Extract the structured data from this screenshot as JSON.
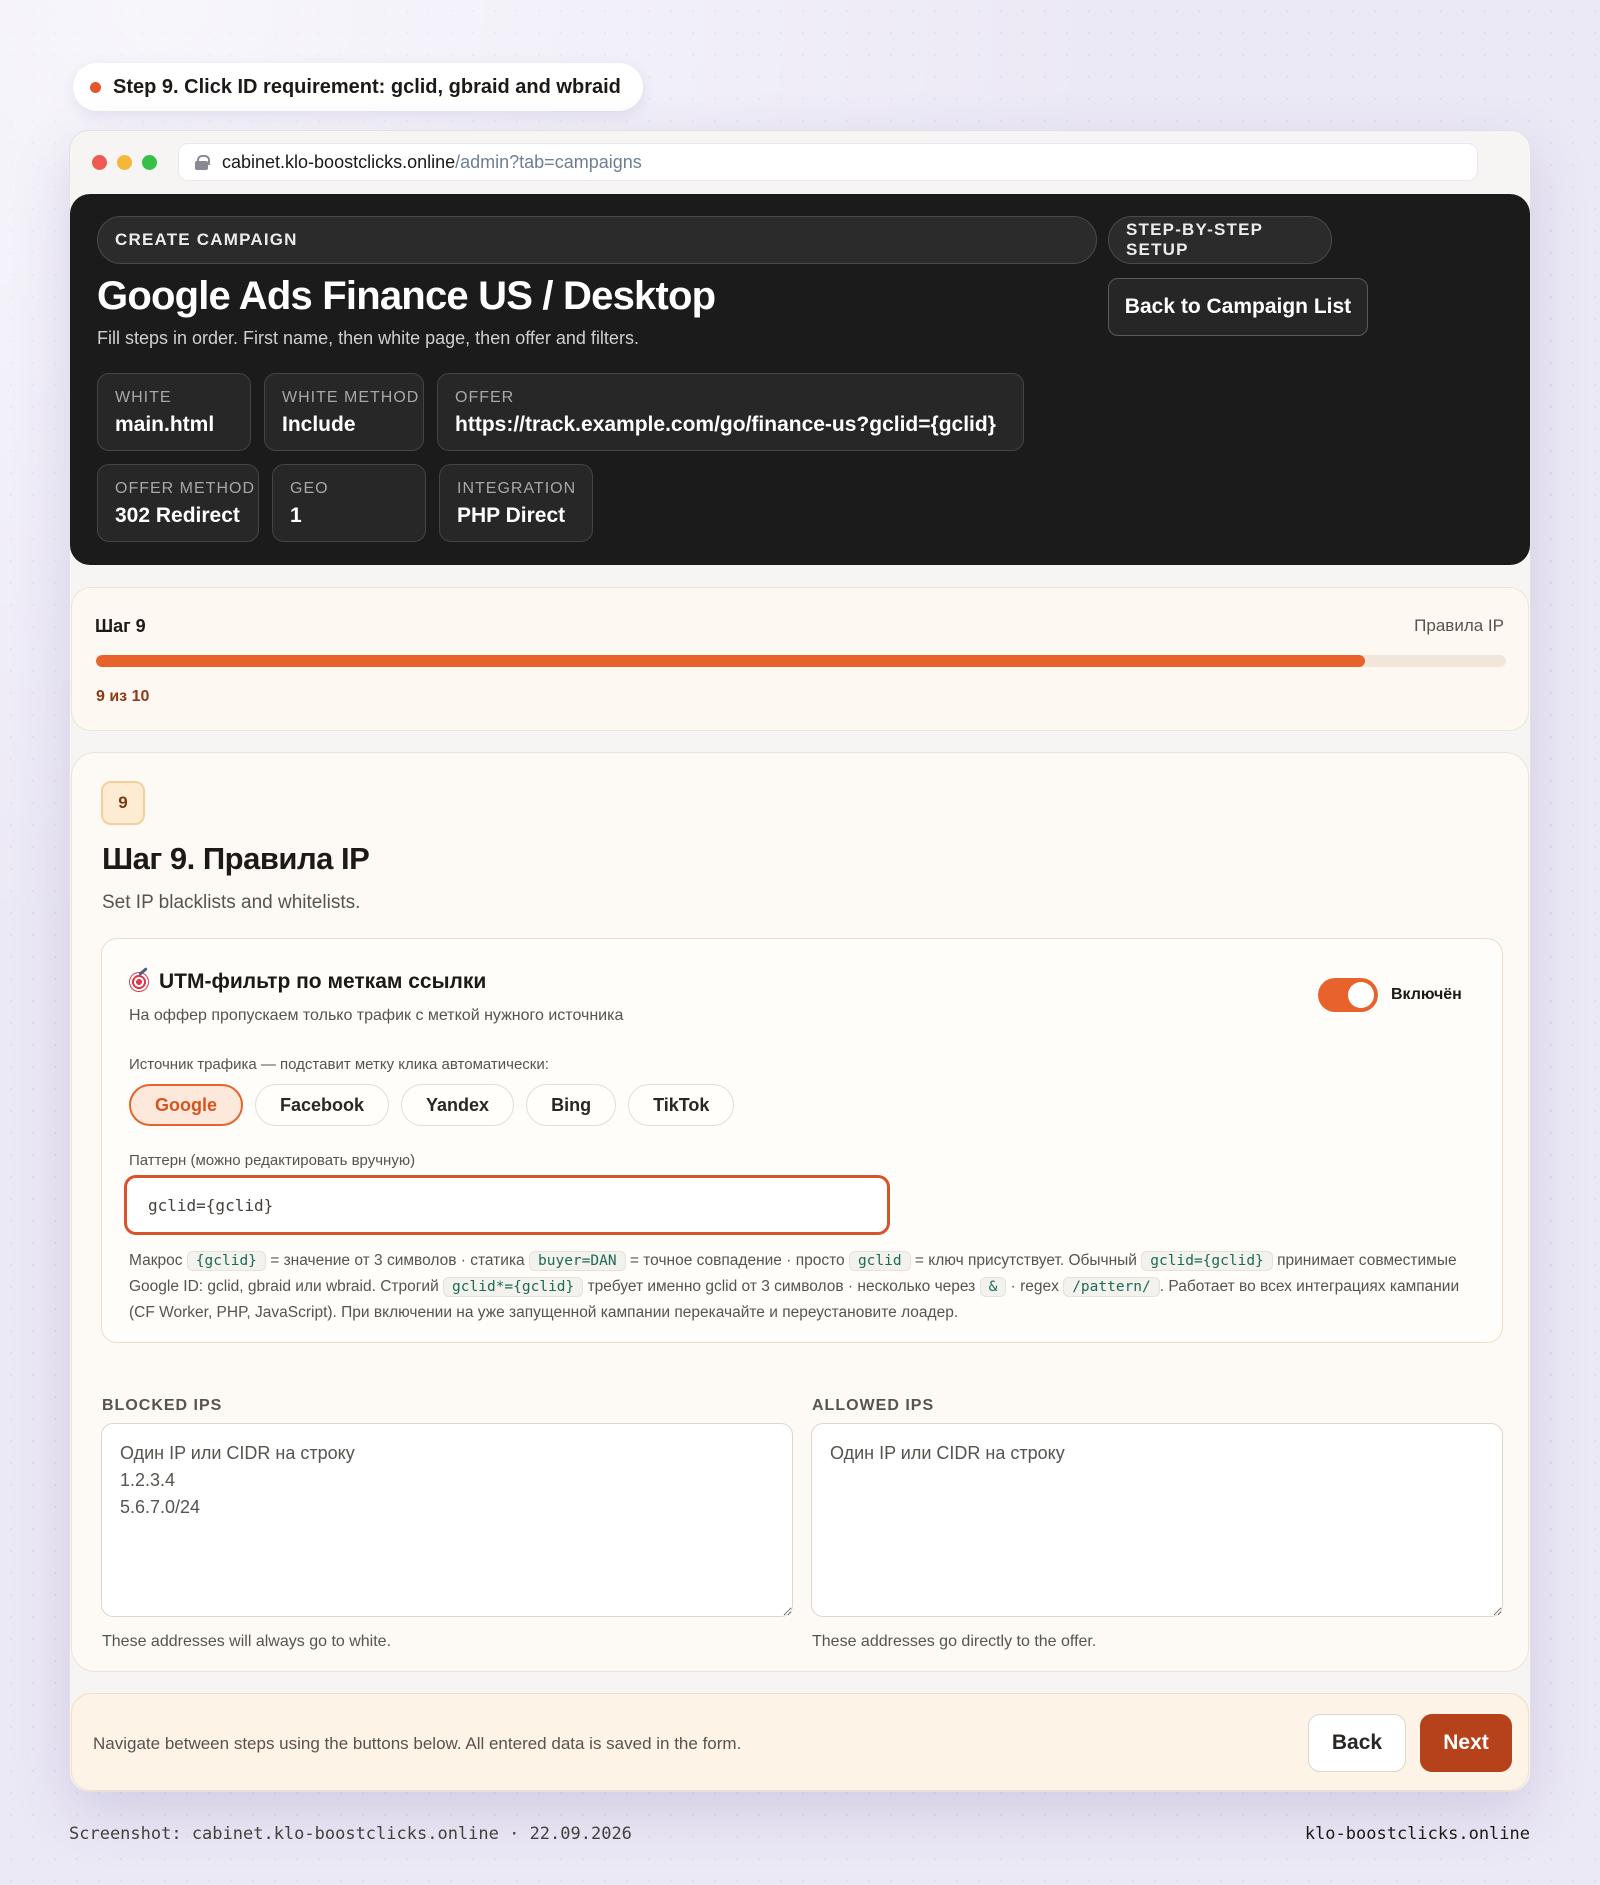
{
  "step_caption": "Step 9. Click ID requirement: gclid, gbraid and wbraid",
  "browser": {
    "url_host": "cabinet.klo-boostclicks.online",
    "url_path": "/admin?tab=campaigns"
  },
  "header": {
    "chip_left": "CREATE CAMPAIGN",
    "chip_right": "STEP-BY-STEP SETUP",
    "title": "Google Ads Finance US / Desktop",
    "subtitle": "Fill steps in order. First name, then white page, then offer and filters.",
    "back_button": "Back to Campaign List",
    "stats": [
      {
        "label": "WHITE",
        "value": "main.html"
      },
      {
        "label": "WHITE METHOD",
        "value": "Include"
      },
      {
        "label": "OFFER",
        "value": "https://track.example.com/go/finance-us?gclid={gclid}"
      },
      {
        "label": "OFFER METHOD",
        "value": "302 Redirect"
      },
      {
        "label": "GEO",
        "value": "1"
      },
      {
        "label": "INTEGRATION",
        "value": "PHP Direct"
      }
    ]
  },
  "progress": {
    "title": "Шаг 9",
    "section": "Правила IP",
    "count_text": "9 из 10",
    "fraction": 0.9,
    "color": "#e8632c"
  },
  "step": {
    "number": "9",
    "heading": "Шаг 9. Правила IP",
    "subtitle": "Set IP blacklists and whitelists."
  },
  "utm": {
    "icon": "target-icon",
    "title": "UTM-фильтр по меткам ссылки",
    "description": "На оффер пропускаем только трафик с меткой нужного источника",
    "toggle_label": "Включён",
    "toggle_on": true,
    "source_label": "Источник трафика — подставит метку клика автоматически:",
    "sources": [
      "Google",
      "Facebook",
      "Yandex",
      "Bing",
      "TikTok"
    ],
    "active_source": "Google",
    "pattern_label": "Паттерн (можно редактировать вручную)",
    "pattern_value": "gclid={gclid}",
    "help": {
      "t1": "Макрос",
      "c1": "{gclid}",
      "t2": "= значение от 3 символов · статика",
      "c2": "buyer=DAN",
      "t3": "= точное совпадение · просто",
      "c3": "gclid",
      "t4": "= ключ присутствует. Обычный",
      "c4": "gclid={gclid}",
      "t5": "принимает совместимые Google ID: gclid, gbraid или wbraid. Строгий",
      "c5": "gclid*={gclid}",
      "t6": "требует именно gclid от 3 символов · несколько через",
      "c6": "&",
      "t7": "· regex",
      "c7": "/pattern/",
      "t8": ". Работает во всех интеграциях кампании (CF Worker, PHP, JavaScript). При включении на уже запущенной кампании перекачайте и переустановите лоадер."
    }
  },
  "ip": {
    "blocked_label": "BLOCKED IPS",
    "blocked_placeholder": "Один IP или CIDR на строку\n1.2.3.4\n5.6.7.0/24",
    "blocked_note": "These addresses will always go to white.",
    "allowed_label": "ALLOWED IPS",
    "allowed_placeholder": "Один IP или CIDR на строку",
    "allowed_note": "These addresses go directly to the offer."
  },
  "nav": {
    "text": "Navigate between steps using the buttons below. All entered data is saved in the form.",
    "back": "Back",
    "next": "Next"
  },
  "footer": {
    "left": "Screenshot: cabinet.klo-boostclicks.online · 22.09.2026",
    "right": "klo-boostclicks.online"
  }
}
